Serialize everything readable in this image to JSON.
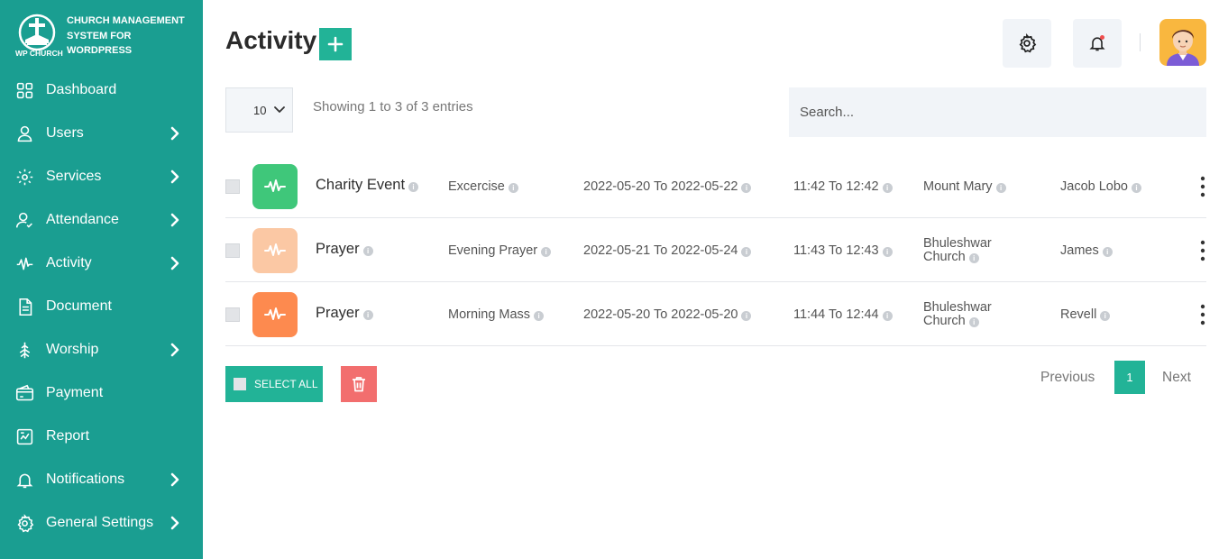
{
  "brand": {
    "title": "CHURCH MANAGEMENT SYSTEM FOR WORDPRESS",
    "logo_text": "WP CHURCH"
  },
  "sidebar": {
    "items": [
      {
        "label": "Dashboard",
        "icon": "dashboard-icon",
        "has_submenu": false
      },
      {
        "label": "Users",
        "icon": "user-icon",
        "has_submenu": true
      },
      {
        "label": "Services",
        "icon": "services-icon",
        "has_submenu": true
      },
      {
        "label": "Attendance",
        "icon": "attendance-icon",
        "has_submenu": true
      },
      {
        "label": "Activity",
        "icon": "activity-icon",
        "has_submenu": true
      },
      {
        "label": "Document",
        "icon": "document-icon",
        "has_submenu": false
      },
      {
        "label": "Worship",
        "icon": "worship-icon",
        "has_submenu": true
      },
      {
        "label": "Payment",
        "icon": "payment-icon",
        "has_submenu": false
      },
      {
        "label": "Report",
        "icon": "report-icon",
        "has_submenu": false
      },
      {
        "label": "Notifications",
        "icon": "bell-icon",
        "has_submenu": true
      },
      {
        "label": "General Settings",
        "icon": "gear-icon",
        "has_submenu": true
      }
    ]
  },
  "header": {
    "title": "Activity",
    "add_icon": "plus-icon",
    "settings_icon": "gear-icon",
    "notifications_icon": "bell-icon"
  },
  "table_controls": {
    "page_size": "10",
    "entries_info": "Showing 1 to 3 of 3 entries",
    "search_placeholder": "Search..."
  },
  "rows": [
    {
      "icon_color": "#3fc77a",
      "title": "Charity Event",
      "category": "Excercise",
      "date_range": "2022-05-20 To 2022-05-22",
      "time_range": "11:42 To 12:42",
      "venue_line1": "Mount Mary",
      "venue_line2": "",
      "person": "Jacob Lobo"
    },
    {
      "icon_color": "#fbc8a4",
      "title": "Prayer",
      "category": "Evening Prayer",
      "date_range": "2022-05-21 To 2022-05-24",
      "time_range": "11:43 To 12:43",
      "venue_line1": "Bhuleshwar",
      "venue_line2": "Church",
      "person": "James"
    },
    {
      "icon_color": "#fd8a4f",
      "title": "Prayer",
      "category": "Morning Mass",
      "date_range": "2022-05-20 To 2022-05-20",
      "time_range": "11:44 To 12:44",
      "venue_line1": "Bhuleshwar",
      "venue_line2": "Church",
      "person": "Revell"
    }
  ],
  "footer": {
    "select_all_label": "SELECT ALL",
    "delete_icon": "trash-icon",
    "previous_label": "Previous",
    "current_page": "1",
    "next_label": "Next"
  },
  "colors": {
    "sidebar_bg": "#1a9e91",
    "accent": "#22b397",
    "danger": "#f26e6e"
  }
}
